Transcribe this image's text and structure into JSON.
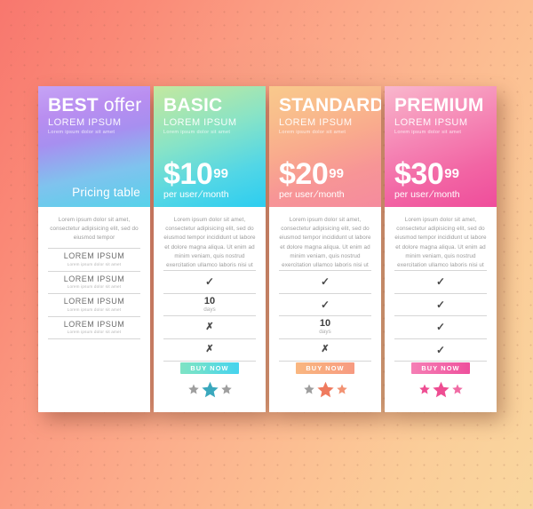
{
  "background": {
    "gradient_from": "#f8776e",
    "gradient_to": "#f9d79f",
    "pattern": "dot-grid"
  },
  "columns": [
    {
      "id": "info",
      "name_bold": "BEST",
      "name_thin": " offer",
      "subtitle": "LOREM IPSUM",
      "subtitle_small": "Lorem ipsum dolor sit amet",
      "pricing_label": "Pricing table",
      "header_gradient_from": "#c5a3f5",
      "header_gradient_to": "#56d2ea",
      "intro": "Lorem ipsum dolor sit amet, consectetur adipisicing elit, sed do eiusmod tempor",
      "features": [
        {
          "label": "LOREM IPSUM",
          "sublabel": "Lorem ipsum dolor sit amet"
        },
        {
          "label": "LOREM IPSUM",
          "sublabel": "Lorem ipsum dolor sit amet"
        },
        {
          "label": "LOREM IPSUM",
          "sublabel": "Lorem ipsum dolor sit amet"
        },
        {
          "label": "LOREM IPSUM",
          "sublabel": "Lorem ipsum dolor sit amet"
        }
      ]
    },
    {
      "id": "basic",
      "name": "BASIC",
      "subtitle": "LOREM IPSUM",
      "subtitle_small": "Lorem ipsum dolor sit amet",
      "price_main": "$10",
      "price_cents": "99",
      "price_per": "per user",
      "price_period": "month",
      "header_gradient_from": "#c3e8a0",
      "header_gradient_to": "#2ccdf0",
      "intro": "Lorem ipsum dolor sit amet, consectetur adipisicing elit, sed do eiusmod tempor incididunt ut labore et dolore magna aliqua. Ut enim ad minim veniam, quis nostrud exercitation ullamco laboris nisi ut",
      "features": [
        {
          "type": "check"
        },
        {
          "type": "days",
          "value": "10",
          "unit": "days"
        },
        {
          "type": "cross"
        },
        {
          "type": "cross"
        }
      ],
      "cta": "BUY NOW",
      "cta_color": "#56d8e2",
      "stars": [
        {
          "size": "small",
          "color": "#9e9e9e"
        },
        {
          "size": "large",
          "color": "#3aa8bd"
        },
        {
          "size": "small",
          "color": "#9e9e9e"
        }
      ]
    },
    {
      "id": "standard",
      "name": "STANDARD",
      "subtitle": "LOREM IPSUM",
      "subtitle_small": "Lorem ipsum dolor sit amet",
      "price_main": "$20",
      "price_cents": "99",
      "price_per": "per user",
      "price_period": "month",
      "header_gradient_from": "#f9c98c",
      "header_gradient_to": "#f58b9e",
      "intro": "Lorem ipsum dolor sit amet, consectetur adipisicing elit, sed do eiusmod tempor incididunt ut labore et dolore magna aliqua. Ut enim ad minim veniam, quis nostrud exercitation ullamco laboris nisi ut",
      "features": [
        {
          "type": "check"
        },
        {
          "type": "check"
        },
        {
          "type": "days",
          "value": "10",
          "unit": "days"
        },
        {
          "type": "cross"
        }
      ],
      "cta": "BUY NOW",
      "cta_color": "#f8a97f",
      "stars": [
        {
          "size": "small",
          "color": "#9e9e9e"
        },
        {
          "size": "large",
          "color": "#ef7a5e"
        },
        {
          "size": "small",
          "color": "#f29272"
        }
      ]
    },
    {
      "id": "premium",
      "name": "PREMIUM",
      "subtitle": "LOREM IPSUM",
      "subtitle_small": "Lorem ipsum dolor sit amet",
      "price_main": "$30",
      "price_cents": "99",
      "price_per": "per user",
      "price_period": "month",
      "header_gradient_from": "#f8b7cd",
      "header_gradient_to": "#ef4d9b",
      "intro": "Lorem ipsum dolor sit amet, consectetur adipisicing elit, sed do eiusmod tempor incididunt ut labore et dolore magna aliqua. Ut enim ad minim veniam, quis nostrud exercitation ullamco laboris nisi ut",
      "features": [
        {
          "type": "check"
        },
        {
          "type": "check"
        },
        {
          "type": "check"
        },
        {
          "type": "check"
        }
      ],
      "cta": "BUY NOW",
      "cta_color": "#f266a8",
      "stars": [
        {
          "size": "small",
          "color": "#ee4d92"
        },
        {
          "size": "large",
          "color": "#ee4d92"
        },
        {
          "size": "small",
          "color": "#f06ba4"
        }
      ]
    }
  ]
}
